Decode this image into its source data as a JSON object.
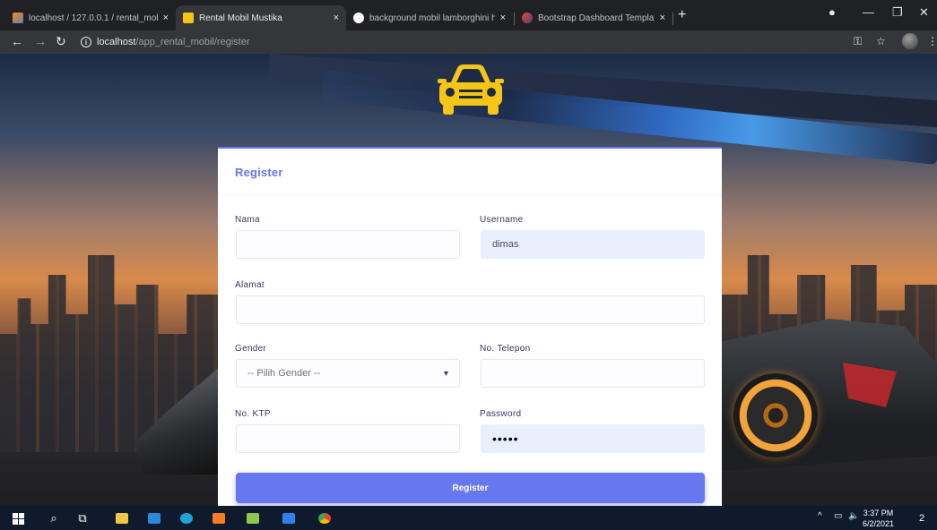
{
  "browser": {
    "tabs": [
      {
        "title": "localhost / 127.0.0.1 / rental_mob",
        "favicon": "phpmyadmin-icon",
        "active": false
      },
      {
        "title": "Rental Mobil Mustika",
        "favicon": "car-favicon-icon",
        "active": true
      },
      {
        "title": "background mobil lamborghini h",
        "favicon": "google-icon",
        "active": false
      },
      {
        "title": "Bootstrap Dashboard Template |",
        "favicon": "bootstrap-icon",
        "active": false
      }
    ],
    "close_glyph": "×",
    "new_tab_glyph": "+",
    "url_host": "localhost",
    "url_path": "/app_rental_mobil/register"
  },
  "form": {
    "title": "Register",
    "nama_label": "Nama",
    "nama_value": "",
    "username_label": "Username",
    "username_value": "dimas",
    "alamat_label": "Alamat",
    "alamat_value": "",
    "gender_label": "Gender",
    "gender_selected": "-- Pilih Gender --",
    "telepon_label": "No. Telepon",
    "telepon_value": "",
    "ktp_label": "No. KTP",
    "ktp_value": "",
    "password_label": "Password",
    "password_mask": "•••••",
    "submit_label": "Register"
  },
  "taskbar": {
    "time": "3:37 PM",
    "date": "6/2/2021",
    "notification_count": "2"
  },
  "colors": {
    "primary": "#6777ef",
    "logo_yellow": "#f5c518",
    "taskbar": "#0f1b2c"
  }
}
